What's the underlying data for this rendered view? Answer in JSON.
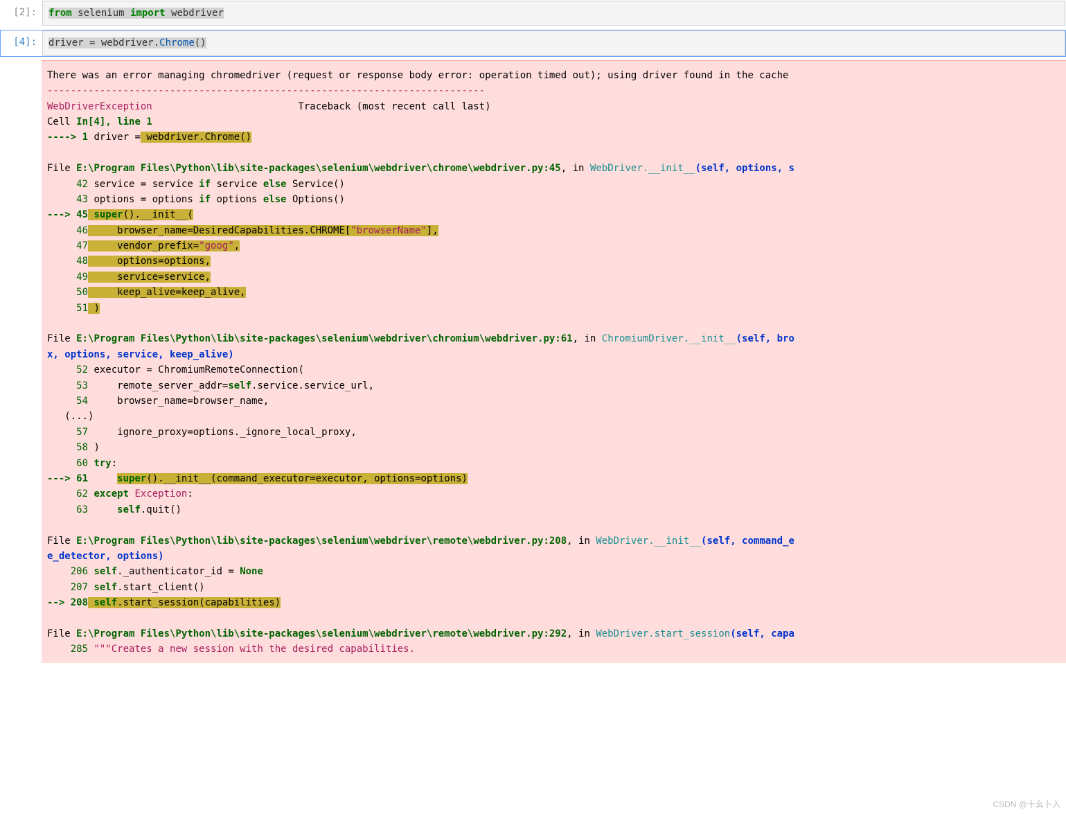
{
  "cell1": {
    "prompt": "[2]:",
    "code_from": "from",
    "code_mod": " selenium ",
    "code_import": "import",
    "code_name": " webdriver"
  },
  "cell2": {
    "prompt": "[4]:",
    "c_driver": "driver ",
    "c_eq": "= ",
    "c_wd": "webdriver",
    "c_dot": ".",
    "c_chrome": "Chrome",
    "c_paren": "()"
  },
  "err": {
    "line1": "There was an error managing chromedriver (request or response body error: operation timed out); using driver found in the cache",
    "dash": "---------------------------------------------------------------------------",
    "exc": "WebDriverException",
    "tb": "                         Traceback (most recent call last)",
    "cell_in_a": "Cell ",
    "cell_in_b": "In[4], line 1",
    "arrow1": "----> 1",
    "arrow1_txt": " driver ",
    "arrow1_eq": "=",
    "arrow1_hl": " webdriver.Chrome()",
    "file1_pre": "File ",
    "file1_path": "E:\\Program Files\\Python\\lib\\site-packages\\selenium\\webdriver\\chrome\\webdriver.py:45",
    "file1_in": ", in ",
    "file1_fn": "WebDriver.__init__",
    "file1_args": "(self, options, s",
    "l42n": "     42",
    "l42": " service ",
    "l42eq": "=",
    "l42b": " service ",
    "l42if": "if",
    "l42c": " service ",
    "l42else": "else",
    "l42d": " Service()",
    "l43n": "     43",
    "l43": " options ",
    "l43eq": "=",
    "l43b": " options ",
    "l43if": "if",
    "l43c": " options ",
    "l43else": "else",
    "l43d": " Options()",
    "l45arrow": "---> 45",
    "l45super": " super",
    "l45rest": "().",
    "l45init": "__init__",
    "l45p": "(",
    "l46n": "     46",
    "l46": "     browser_name",
    "l46eq": "=",
    "l46b": "DesiredCapabilities.CHROME[",
    "l46s": "\"browserName\"",
    "l46c": "],",
    "l47n": "     47",
    "l47": "     vendor_prefix",
    "l47eq": "=",
    "l47s": "\"goog\"",
    "l47c": ",",
    "l48n": "     48",
    "l48": "     options",
    "l48eq": "=",
    "l48b": "options,",
    "l49n": "     49",
    "l49": "     service",
    "l49eq": "=",
    "l49b": "service,",
    "l50n": "     50",
    "l50": "     keep_alive",
    "l50eq": "=",
    "l50b": "keep_alive,",
    "l51n": "     51",
    "l51": " )",
    "file2_pre": "File ",
    "file2_path": "E:\\Program Files\\Python\\lib\\site-packages\\selenium\\webdriver\\chromium\\webdriver.py:61",
    "file2_in": ", in ",
    "file2_fn": "ChromiumDriver.__init__",
    "file2_args": "(self, bro",
    "file2_args2": "x, options, service, keep_alive)",
    "l52n": "     52",
    "l52": " executor ",
    "l52eq": "=",
    "l52b": " ChromiumRemoteConnection(",
    "l53n": "     53",
    "l53": "     remote_server_addr",
    "l53eq": "=",
    "l53b": "self",
    "l53c": ".service.service_url,",
    "l54n": "     54",
    "l54": "     browser_name",
    "l54eq": "=",
    "l54b": "browser_name,",
    "ldots": "   (...)",
    "l57n": "     57",
    "l57": "     ignore_proxy",
    "l57eq": "=",
    "l57b": "options._ignore_local_proxy,",
    "l58n": "     58",
    "l58": " )",
    "l60n": "     60",
    "l60": " try",
    "l60c": ":",
    "l61arrow": "---> 61",
    "l61sp": "     ",
    "l61super": "super",
    "l61rest": "().",
    "l61init": "__init__",
    "l61args": "(command_executor",
    "l61eq": "=",
    "l61b": "executor, options",
    "l61eq2": "=",
    "l61c": "options)",
    "l62n": "     62",
    "l62": " except",
    "l62b": " Exception",
    "l62c": ":",
    "l63n": "     63",
    "l63": "     self",
    "l63b": ".quit()",
    "file3_pre": "File ",
    "file3_path": "E:\\Program Files\\Python\\lib\\site-packages\\selenium\\webdriver\\remote\\webdriver.py:208",
    "file3_in": ", in ",
    "file3_fn": "WebDriver.__init__",
    "file3_args": "(self, command_e",
    "file3_args2": "e_detector, options)",
    "l206n": "    206",
    "l206": " self",
    "l206b": "._authenticator_id ",
    "l206eq": "=",
    "l206none": " None",
    "l207n": "    207",
    "l207": " self",
    "l207b": ".start_client()",
    "l208arrow": "--> 208",
    "l208": " self",
    "l208b": ".start_session(capabilities)",
    "file4_pre": "File ",
    "file4_path": "E:\\Program Files\\Python\\lib\\site-packages\\selenium\\webdriver\\remote\\webdriver.py:292",
    "file4_in": ", in ",
    "file4_fn": "WebDriver.start_session",
    "file4_args": "(self, capa",
    "l285n": "    285",
    "l285": " \"\"\"Creates a new session with the desired capabilities."
  },
  "watermark": "CSDN @十幺卜入"
}
